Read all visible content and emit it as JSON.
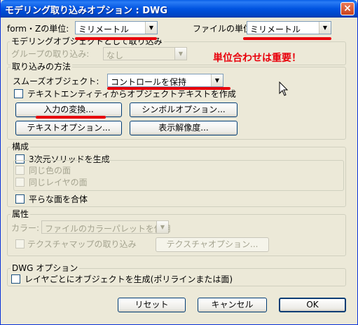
{
  "window": {
    "title": "モデリング取り込みオプション : DWG",
    "close_glyph": "×"
  },
  "units": {
    "form_z_label": "form・Zの単位:",
    "form_z_value": "ミリメートル",
    "file_label": "ファイルの単位:",
    "file_value": "ミリメートル"
  },
  "modeling_group": {
    "title": "モデリングオブジェクトとして取り込み",
    "group_import_label": "グループの取り込み:",
    "group_import_value": "なし"
  },
  "annotation": {
    "text": "単位合わせは重要！"
  },
  "import_method": {
    "title": "取り込みの方法",
    "smooth_label": "スムーズオブジェクト:",
    "smooth_value": "コントロールを保持",
    "text_entity_label": "テキストエンティティからオブジェクトテキストを作成",
    "input_transform_btn": "入力の変換...",
    "symbol_options_btn": "シンボルオプション...",
    "text_options_btn": "テキストオプション...",
    "display_resolution_btn": "表示解像度..."
  },
  "structure": {
    "title": "構成",
    "solid_label": "3次元ソリッドを生成",
    "same_color_label": "同じ色の面",
    "same_layer_label": "同じレイヤの面",
    "merge_flat_label": "平らな面を合体"
  },
  "attributes": {
    "title": "属性",
    "color_label": "カラー:",
    "color_value": "ファイルのカラーパレットを使用",
    "texture_map_label": "テクスチャマップの取り込み",
    "texture_options_btn": "テクスチャオプション..."
  },
  "dwg": {
    "title": "DWG オプション",
    "per_layer_label": "レイヤごとにオブジェクトを生成(ポリラインまたは面)"
  },
  "footer": {
    "reset_btn": "リセット",
    "cancel_btn": "キャンセル",
    "ok_btn": "OK"
  },
  "colors": {
    "titlebar": "#0053e0",
    "dialog_bg": "#ece9d8",
    "annotation_red": "#e8000b"
  }
}
